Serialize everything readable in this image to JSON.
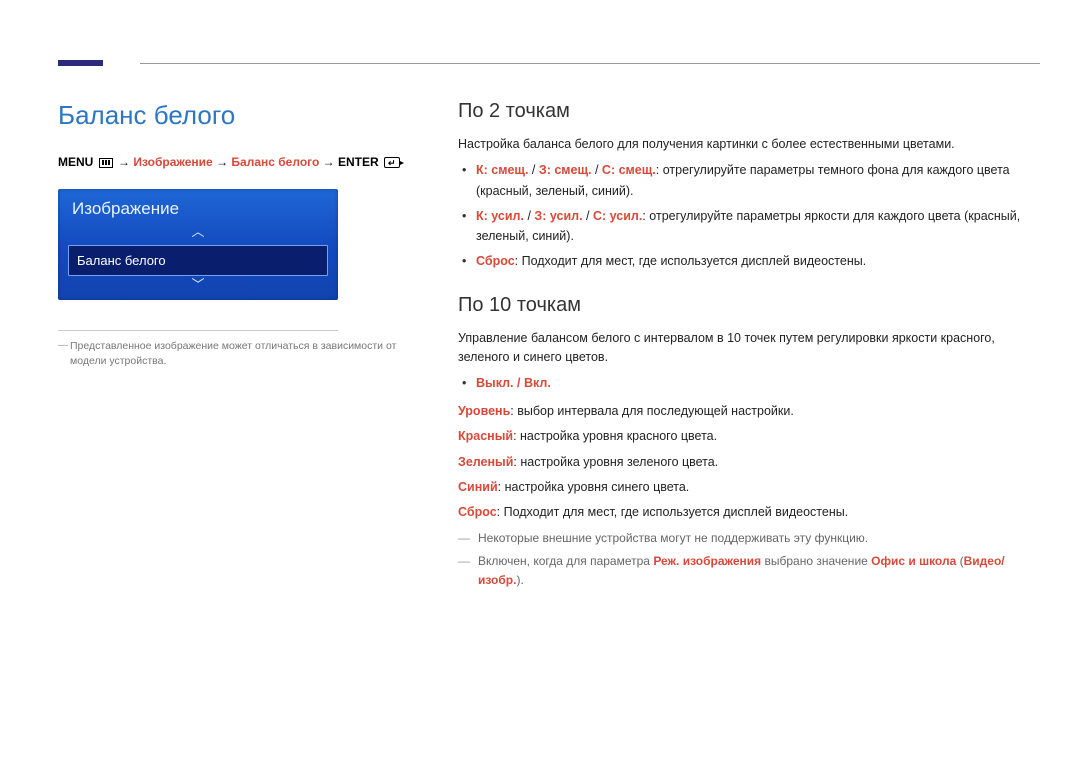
{
  "main_title": "Баланс белого",
  "breadcrumb": {
    "menu": "MENU",
    "arrow": " → ",
    "p1": "Изображение",
    "p2": "Баланс белого",
    "enter": "ENTER"
  },
  "menu": {
    "title": "Изображение",
    "item": "Баланс белого"
  },
  "left_footnote": "Представленное изображение может отличаться в зависимости от модели устройства.",
  "sec1": {
    "title": "По 2 точкам",
    "intro": "Настройка баланса белого для получения картинки с более естественными цветами.",
    "b1a": "К: смещ.",
    "b1b": "З: смещ.",
    "b1c": "С: смещ.",
    "b1_tail": ": отрегулируйте параметры темного фона для каждого цвета (красный, зеленый, синий).",
    "b2a": "К: усил.",
    "b2b": "З: усил.",
    "b2c": "С: усил.",
    "b2_tail": ": отрегулируйте параметры яркости для каждого цвета (красный, зеленый, синий).",
    "b3_label": "Сброс",
    "b3_tail": ": Подходит для мест, где используется дисплей видеостены."
  },
  "sec2": {
    "title": "По 10 точкам",
    "intro": "Управление балансом белого с интервалом в 10 точек путем регулировки яркости красного, зеленого и синего цветов.",
    "toggle": "Выкл. / Вкл.",
    "l1_label": "Уровень",
    "l1_tail": ": выбор интервала для последующей настройки.",
    "l2_label": "Красный",
    "l2_tail": ": настройка уровня красного цвета.",
    "l3_label": "Зеленый",
    "l3_tail": ": настройка уровня зеленого цвета.",
    "l4_label": "Синий",
    "l4_tail": ": настройка уровня синего цвета.",
    "l5_label": "Сброс",
    "l5_tail": ": Подходит для мест, где используется дисплей видеостены.",
    "note1": "Некоторые внешние устройства могут не поддерживать эту функцию.",
    "note2_pre": "Включен, когда для параметра ",
    "note2_a": "Реж. изображения",
    "note2_mid": " выбрано значение ",
    "note2_b": "Офис и школа",
    "note2_paren_open": " (",
    "note2_c": "Видео/изобр.",
    "note2_paren_close": ")."
  }
}
